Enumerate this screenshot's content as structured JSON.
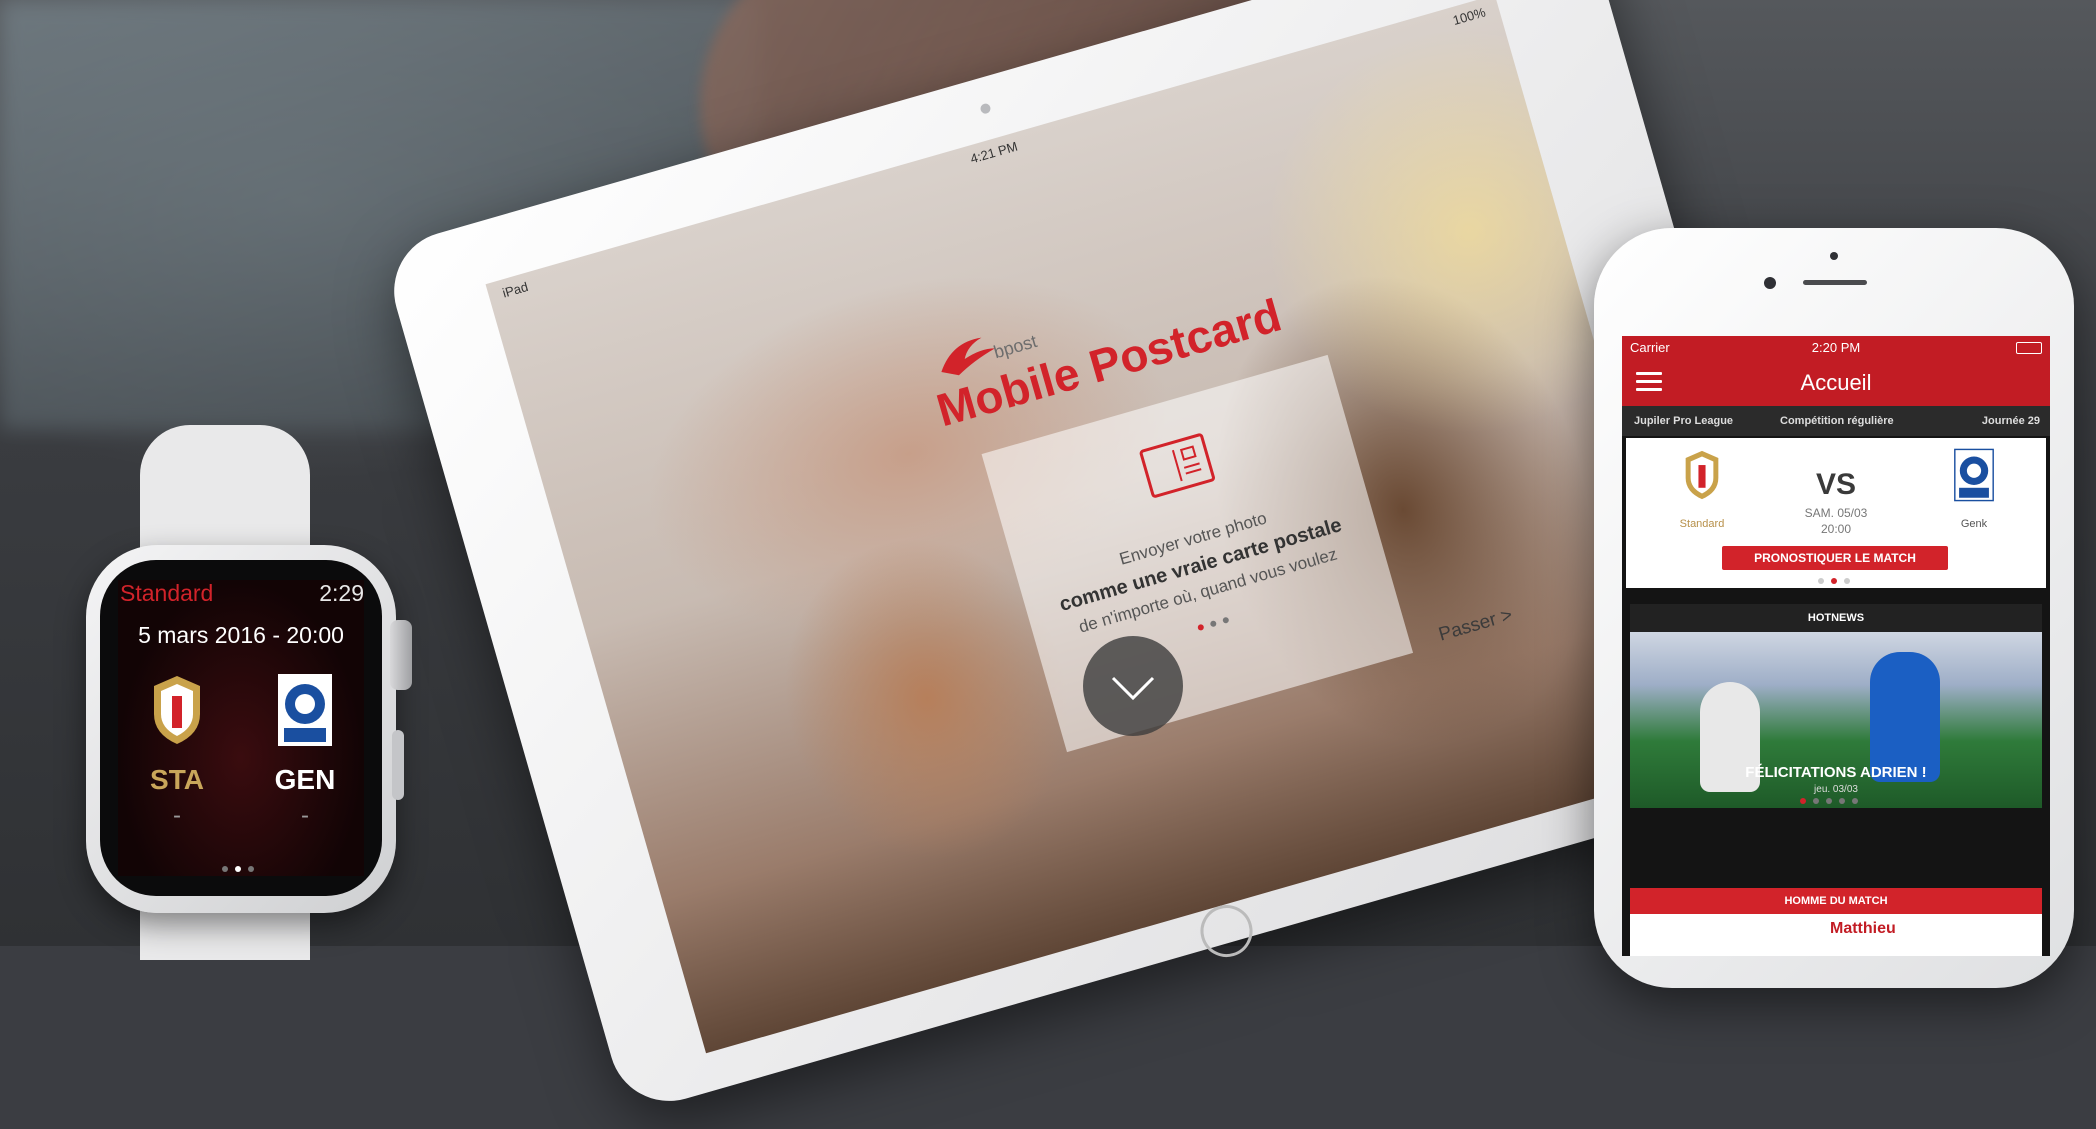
{
  "watch": {
    "club": "Standard",
    "time": "2:29",
    "date": "5 mars 2016 - 20:00",
    "home_abbr": "STA",
    "away_abbr": "GEN",
    "home_score": "-",
    "away_score": "-",
    "home_logo_icon": "standard-crest-icon",
    "away_logo_icon": "genk-crest-icon"
  },
  "ipad": {
    "carrier": "iPad",
    "time": "4:21 PM",
    "battery": "100%",
    "brand": "bpost",
    "title": "Mobile Postcard",
    "card_line1": "Envoyer votre photo",
    "card_line2": "comme une vraie carte postale",
    "card_line3": "de n'importe où, quand vous voulez",
    "skip": "Passer >",
    "postcard_icon": "postcard-icon",
    "scroll_icon": "chevron-down-icon"
  },
  "iphone": {
    "carrier": "Carrier",
    "time": "2:20 PM",
    "title": "Accueil",
    "league": "Jupiler Pro League",
    "competition": "Compétition régulière",
    "matchday": "Journée 29",
    "vs": "VS",
    "match_date": "SAM. 05/03",
    "match_hour": "20:00",
    "home_team": "Standard",
    "away_team": "Genk",
    "predict_button": "PRONOSTIQUER LE MATCH",
    "hotnews_title": "HOTNEWS",
    "hotnews_headline": "FÉLICITATIONS ADRIEN !",
    "hotnews_date": "jeu. 03/03",
    "motm_title": "HOMME DU MATCH",
    "motm_name": "Matthieu"
  },
  "colors": {
    "brand_red": "#d2232a",
    "header_red": "#c21c24"
  }
}
